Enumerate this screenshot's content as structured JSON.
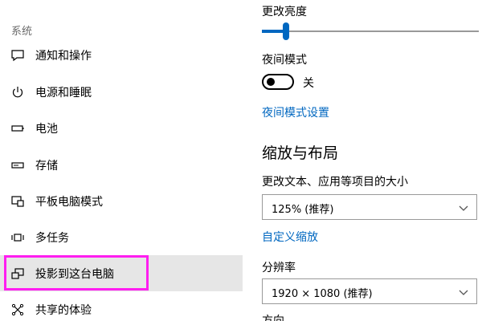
{
  "sidebar": {
    "section_label": "系统",
    "items": [
      {
        "label": "通知和操作",
        "icon": "notification-icon"
      },
      {
        "label": "电源和睡眠",
        "icon": "power-icon"
      },
      {
        "label": "电池",
        "icon": "battery-icon"
      },
      {
        "label": "存储",
        "icon": "storage-icon"
      },
      {
        "label": "平板电脑模式",
        "icon": "tablet-mode-icon"
      },
      {
        "label": "多任务",
        "icon": "multitasking-icon"
      },
      {
        "label": "投影到这台电脑",
        "icon": "projecting-icon",
        "selected": true
      },
      {
        "label": "共享的体验",
        "icon": "shared-experiences-icon"
      }
    ],
    "highlight_color": "#ff1ef0"
  },
  "main": {
    "brightness": {
      "label": "更改亮度",
      "value_fraction": 0.11
    },
    "night_light": {
      "label": "夜间模式",
      "toggle_state": "关",
      "settings_link": "夜间模式设置"
    },
    "scale_layout": {
      "heading": "缩放与布局",
      "size_label": "更改文本、应用等项目的大小",
      "size_value": "125% (推荐)",
      "custom_scaling_link": "自定义缩放",
      "resolution_label": "分辨率",
      "resolution_value": "1920 × 1080 (推荐)",
      "orientation_label": "方向"
    }
  },
  "colors": {
    "accent": "#0067c0",
    "selected_bg": "#e6e6e6"
  }
}
